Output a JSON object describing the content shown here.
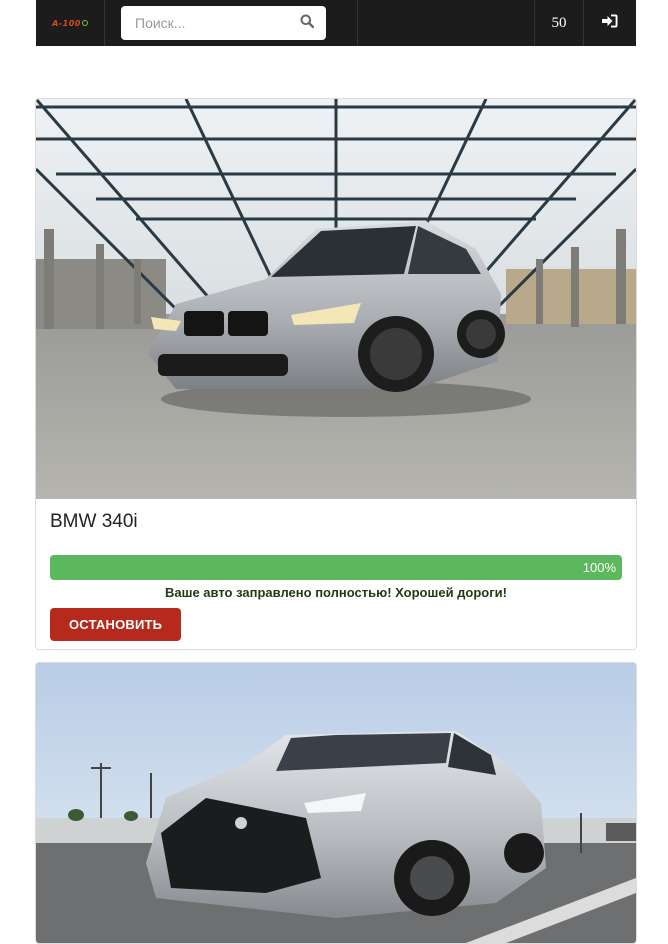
{
  "header": {
    "logo_text": "A-100",
    "search_placeholder": "Поиск...",
    "count": "50",
    "icons": {
      "search": "search-icon",
      "login": "sign-in-icon"
    }
  },
  "cards": [
    {
      "title": "BMW 340i",
      "progress": 1.0,
      "progress_label": "100%",
      "status": "Ваше авто заправлено полностью! Хорошей дороги!",
      "button_label": "ОСТАНОВИТЬ",
      "image": "silver-bmw-sedan-in-parking-garage"
    },
    {
      "image": "silver-lexus-is-on-highway"
    }
  ],
  "colors": {
    "navbar": "#1c1c1c",
    "progress": "#5cb85c",
    "stop_button": "#b52a1c",
    "logo": "#e04a1a"
  }
}
